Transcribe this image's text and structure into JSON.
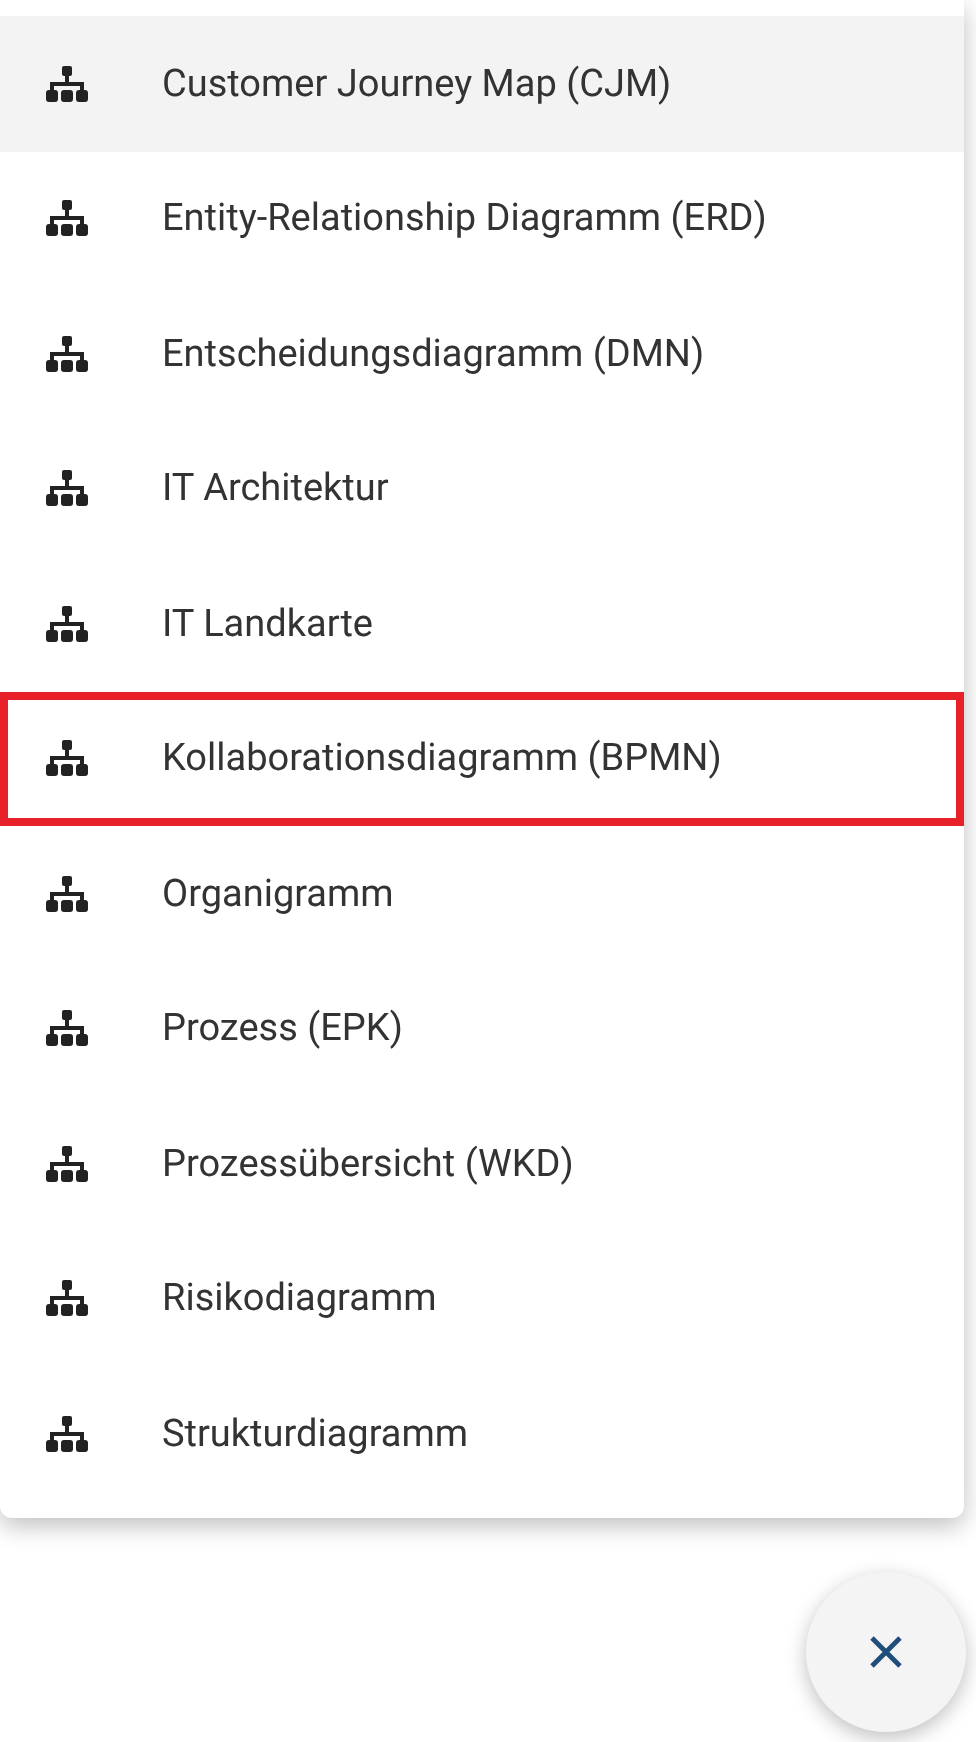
{
  "menu": {
    "items": [
      {
        "label": "Customer Journey Map (CJM)",
        "highlighted": true,
        "outlined": false
      },
      {
        "label": "Entity-Relationship Diagramm (ERD)",
        "highlighted": false,
        "outlined": false
      },
      {
        "label": "Entscheidungsdiagramm (DMN)",
        "highlighted": false,
        "outlined": false
      },
      {
        "label": "IT Architektur",
        "highlighted": false,
        "outlined": false
      },
      {
        "label": "IT Landkarte",
        "highlighted": false,
        "outlined": false
      },
      {
        "label": "Kollaborationsdiagramm (BPMN)",
        "highlighted": false,
        "outlined": true
      },
      {
        "label": "Organigramm",
        "highlighted": false,
        "outlined": false
      },
      {
        "label": "Prozess (EPK)",
        "highlighted": false,
        "outlined": false
      },
      {
        "label": "Prozessübersicht (WKD)",
        "highlighted": false,
        "outlined": false
      },
      {
        "label": "Risikodiagramm",
        "highlighted": false,
        "outlined": false
      },
      {
        "label": "Strukturdiagramm",
        "highlighted": false,
        "outlined": false
      }
    ]
  }
}
